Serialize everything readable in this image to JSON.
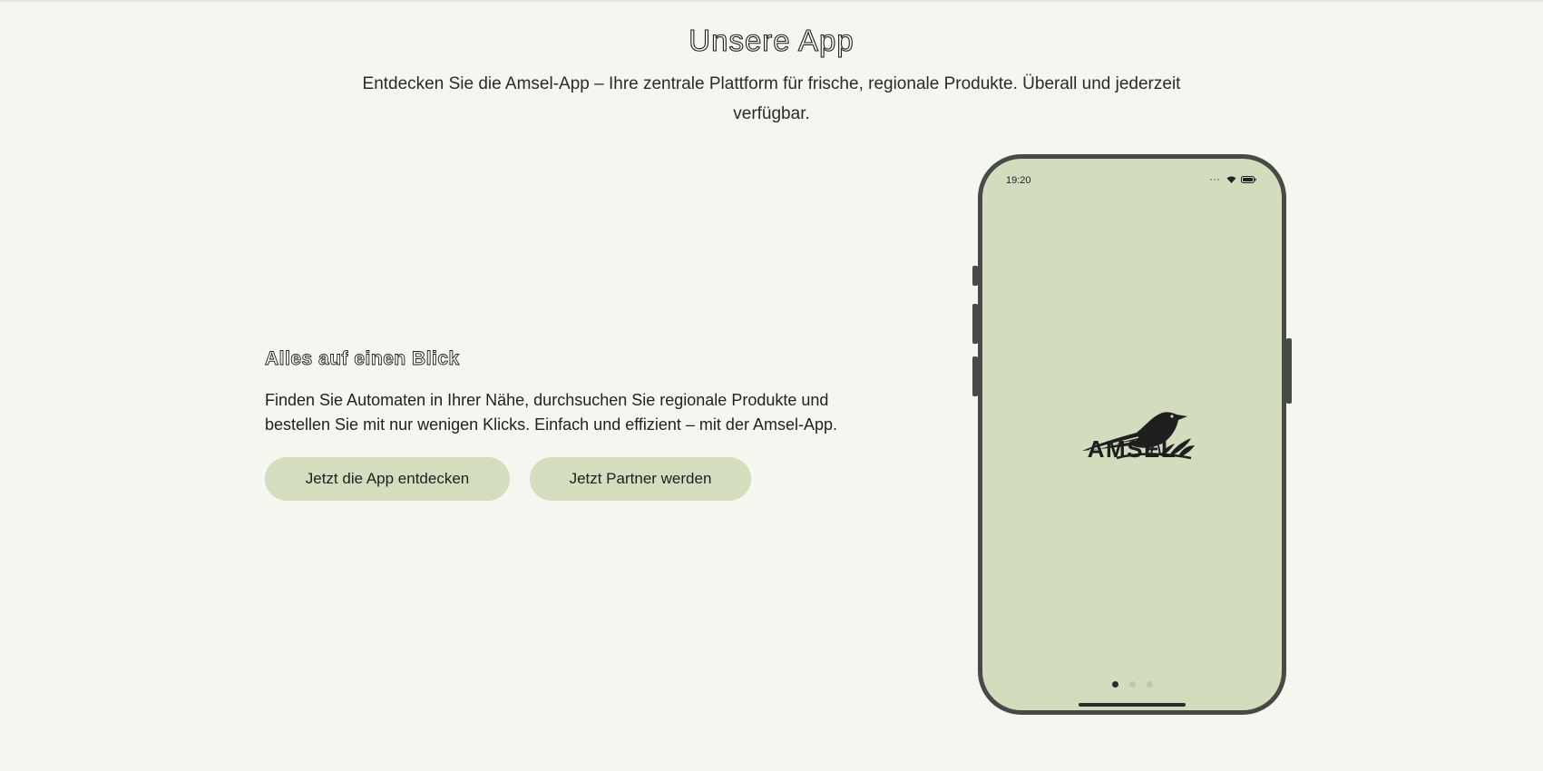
{
  "header": {
    "title": "Unsere App",
    "subtitle": "Entdecken Sie die Amsel-App – Ihre zentrale Plattform für frische, regionale Produkte. Überall und jederzeit verfügbar."
  },
  "feature": {
    "title": "Alles auf einen Blick",
    "text": "Finden Sie Automaten in Ihrer Nähe, durchsuchen Sie regionale Produkte und bestellen Sie mit nur wenigen Klicks. Einfach und effizient – mit der Amsel-App."
  },
  "buttons": {
    "discover_label": "Jetzt die App entdecken",
    "partner_label": "Jetzt Partner werden"
  },
  "phone": {
    "status_time": "19:20",
    "logo_text": "AMSEL",
    "carousel": {
      "total": 3,
      "active": 1
    },
    "icons": [
      "signal-icon",
      "wifi-icon",
      "battery-icon",
      "bird-logo-icon"
    ]
  },
  "colors": {
    "background": "#f5f6f0",
    "button": "#d4ddbe",
    "phone_screen": "#d3ddbe",
    "phone_frame": "#474a46"
  }
}
